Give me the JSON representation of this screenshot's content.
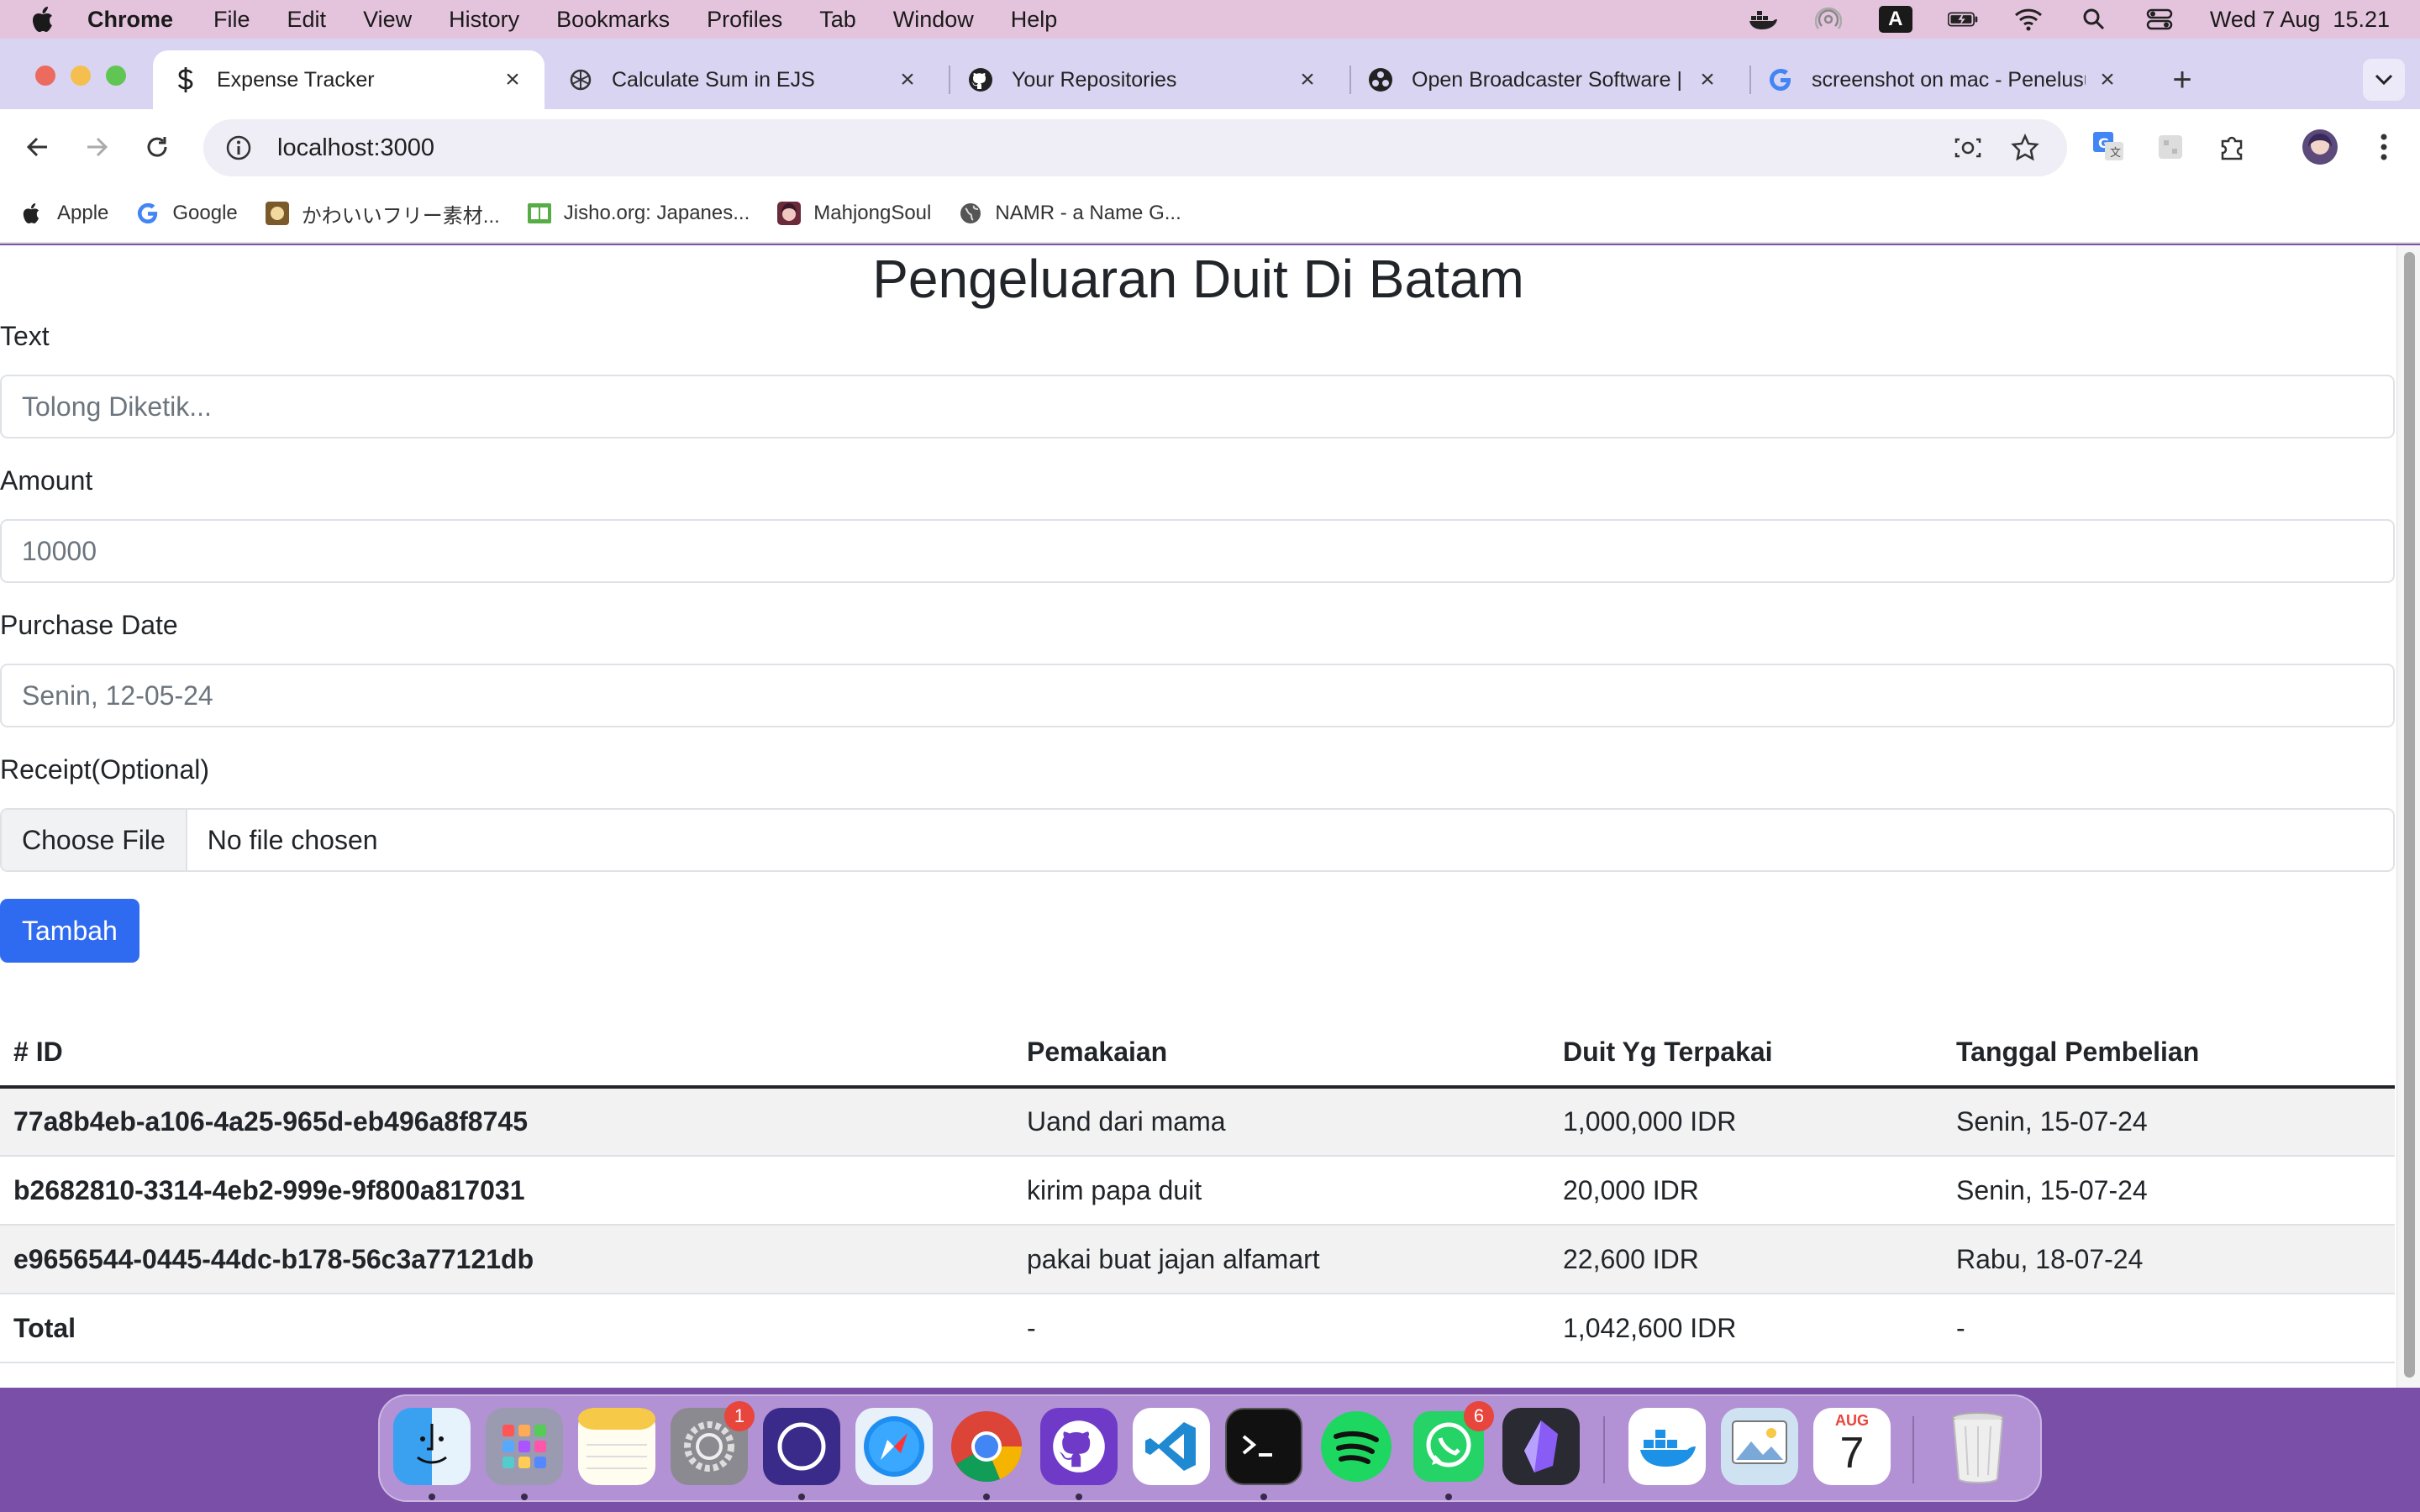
{
  "menubar": {
    "app_name": "Chrome",
    "items": [
      "File",
      "Edit",
      "View",
      "History",
      "Bookmarks",
      "Profiles",
      "Tab",
      "Window",
      "Help"
    ],
    "status_icons": [
      "docker-icon",
      "airdrop-icon",
      "input-source-icon",
      "battery-icon",
      "wifi-icon",
      "spotlight-icon",
      "control-center-icon"
    ],
    "input_source": "A",
    "clock": "Wed 7 Aug  15.21"
  },
  "tabs": [
    {
      "title": "Expense Tracker",
      "icon": "dollar-icon",
      "active": true
    },
    {
      "title": "Calculate Sum in EJS",
      "icon": "openai-icon",
      "active": false
    },
    {
      "title": "Your Repositories",
      "icon": "github-icon",
      "active": false
    },
    {
      "title": "Open Broadcaster Software |",
      "icon": "obs-icon",
      "active": false
    },
    {
      "title": "screenshot on mac - Penelusu",
      "icon": "google-icon",
      "active": false
    }
  ],
  "toolbar": {
    "url": "localhost:3000"
  },
  "bookmarks": [
    {
      "label": "Apple",
      "icon": "apple-icon"
    },
    {
      "label": "Google",
      "icon": "google-icon"
    },
    {
      "label": "かわいいフリー素材...",
      "icon": "irasutoya-icon"
    },
    {
      "label": "Jisho.org: Japanes...",
      "icon": "jisho-icon"
    },
    {
      "label": "MahjongSoul",
      "icon": "mahjongsoul-icon"
    },
    {
      "label": "NAMR - a Name G...",
      "icon": "globe-icon"
    }
  ],
  "page": {
    "title": "Pengeluaran Duit Di Batam",
    "form": {
      "text_label": "Text",
      "text_placeholder": "Tolong Diketik...",
      "amount_label": "Amount",
      "amount_placeholder": "10000",
      "date_label": "Purchase Date",
      "date_placeholder": "Senin, 12-05-24",
      "receipt_label": "Receipt(Optional)",
      "choose_file": "Choose File",
      "no_file": "No file chosen",
      "submit": "Tambah"
    },
    "table": {
      "headers": [
        "# ID",
        "Pemakaian",
        "Duit Yg Terpakai",
        "Tanggal Pembelian"
      ],
      "rows": [
        [
          "77a8b4eb-a106-4a25-965d-eb496a8f8745",
          "Uand dari mama",
          "1,000,000 IDR",
          "Senin, 15-07-24"
        ],
        [
          "b2682810-3314-4eb2-999e-9f800a817031",
          "kirim papa duit",
          "20,000 IDR",
          "Senin, 15-07-24"
        ],
        [
          "e9656544-0445-44dc-b178-56c3a77121db",
          "pakai buat jajan alfamart",
          "22,600 IDR",
          "Rabu, 18-07-24"
        ]
      ],
      "total": [
        "Total",
        "-",
        "1,042,600 IDR",
        "-"
      ]
    }
  },
  "dock": {
    "apps": [
      "finder-icon",
      "launchpad-icon",
      "notes-icon",
      "system-settings-icon",
      "tor-browser-icon",
      "safari-icon",
      "chrome-icon",
      "github-desktop-icon",
      "vscode-icon",
      "terminal-icon",
      "spotify-icon",
      "whatsapp-icon",
      "obsidian-icon",
      "docker-icon",
      "preview-icon",
      "calendar-icon",
      "trash-icon"
    ],
    "badges": {
      "system_settings": "1",
      "whatsapp": "6"
    },
    "calendar_month": "AUG",
    "calendar_day": "7"
  }
}
